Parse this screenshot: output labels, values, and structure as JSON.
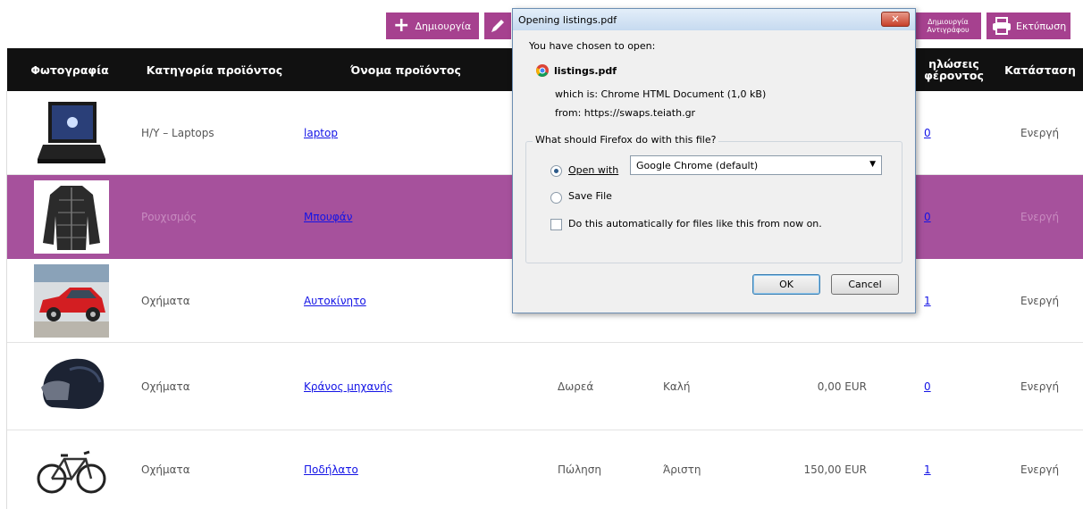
{
  "toolbar": {
    "create_label": "Δημιουργία",
    "copy_line1": "Δημιουργία",
    "copy_line2": "Αντιγράφου",
    "print_label": "Εκτύπωση"
  },
  "table": {
    "headers": {
      "photo": "Φωτογραφία",
      "category": "Κατηγορία προϊόντος",
      "name": "Όνομα προϊόντος",
      "interest_1": "ηλώσεις",
      "interest_2": "φέροντος",
      "status": "Κατάσταση"
    },
    "rows": [
      {
        "icon": "laptop-photo",
        "category": "H/Y – Laptops",
        "name": "laptop",
        "type": "",
        "condition": "",
        "price": "",
        "interest": "0",
        "status": "Ενεργή"
      },
      {
        "icon": "jacket-photo",
        "category": "Ρουχισμός",
        "name": "Μπουφάν",
        "type": "",
        "condition": "",
        "price": "",
        "interest": "0",
        "status": "Ενεργή"
      },
      {
        "icon": "car-photo",
        "category": "Οχήματα",
        "name": "Αυτοκίνητο",
        "type": "",
        "condition": "",
        "price": "",
        "interest": "1",
        "status": "Ενεργή"
      },
      {
        "icon": "helmet-photo",
        "category": "Οχήματα",
        "name": "Κράνος μηχανής",
        "type": "Δωρεά",
        "condition": "Καλή",
        "price": "0,00 EUR",
        "interest": "0",
        "status": "Ενεργή"
      },
      {
        "icon": "bicycle-photo",
        "category": "Οχήματα",
        "name": "Ποδήλατο",
        "type": "Πώληση",
        "condition": "Άριστη",
        "price": "150,00 EUR",
        "interest": "1",
        "status": "Ενεργή"
      }
    ]
  },
  "dialog": {
    "title": "Opening listings.pdf",
    "close_glyph": "✕",
    "intro": "You have chosen to open:",
    "filename": "listings.pdf",
    "which_is": "which is:  Chrome HTML Document (1,0 kB)",
    "from": "from:  https://swaps.teiath.gr",
    "question": "What should Firefox do with this file?",
    "open_with_label": "Open with",
    "open_with_value": "Google Chrome (default)",
    "save_file_label": "Save File",
    "auto_label": "Do this automatically for files like this from now on.",
    "ok_label": "OK",
    "cancel_label": "Cancel"
  },
  "colors": {
    "accent": "#a6418f",
    "highlight_row": "#a6519c",
    "header_bg": "#111111",
    "link": "#1414e6"
  }
}
